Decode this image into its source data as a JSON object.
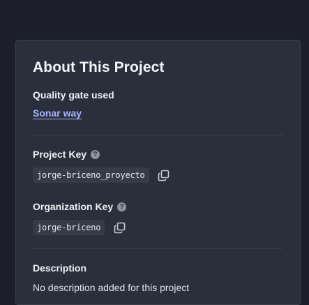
{
  "about": {
    "title": "About This Project",
    "quality_gate": {
      "label": "Quality gate used",
      "value": "Sonar way"
    },
    "project_key": {
      "label": "Project Key",
      "help_glyph": "?",
      "value": "jorge-briceno_proyecto"
    },
    "organization_key": {
      "label": "Organization Key",
      "help_glyph": "?",
      "value": "jorge-briceno"
    },
    "description": {
      "label": "Description",
      "text": "No description added for this project"
    }
  },
  "icons": {
    "help": "question-circle-icon",
    "copy": "copy-icon"
  },
  "colors": {
    "background": "#1c1f2b",
    "panel": "#2a2f3c",
    "link": "#a9b4ff"
  }
}
